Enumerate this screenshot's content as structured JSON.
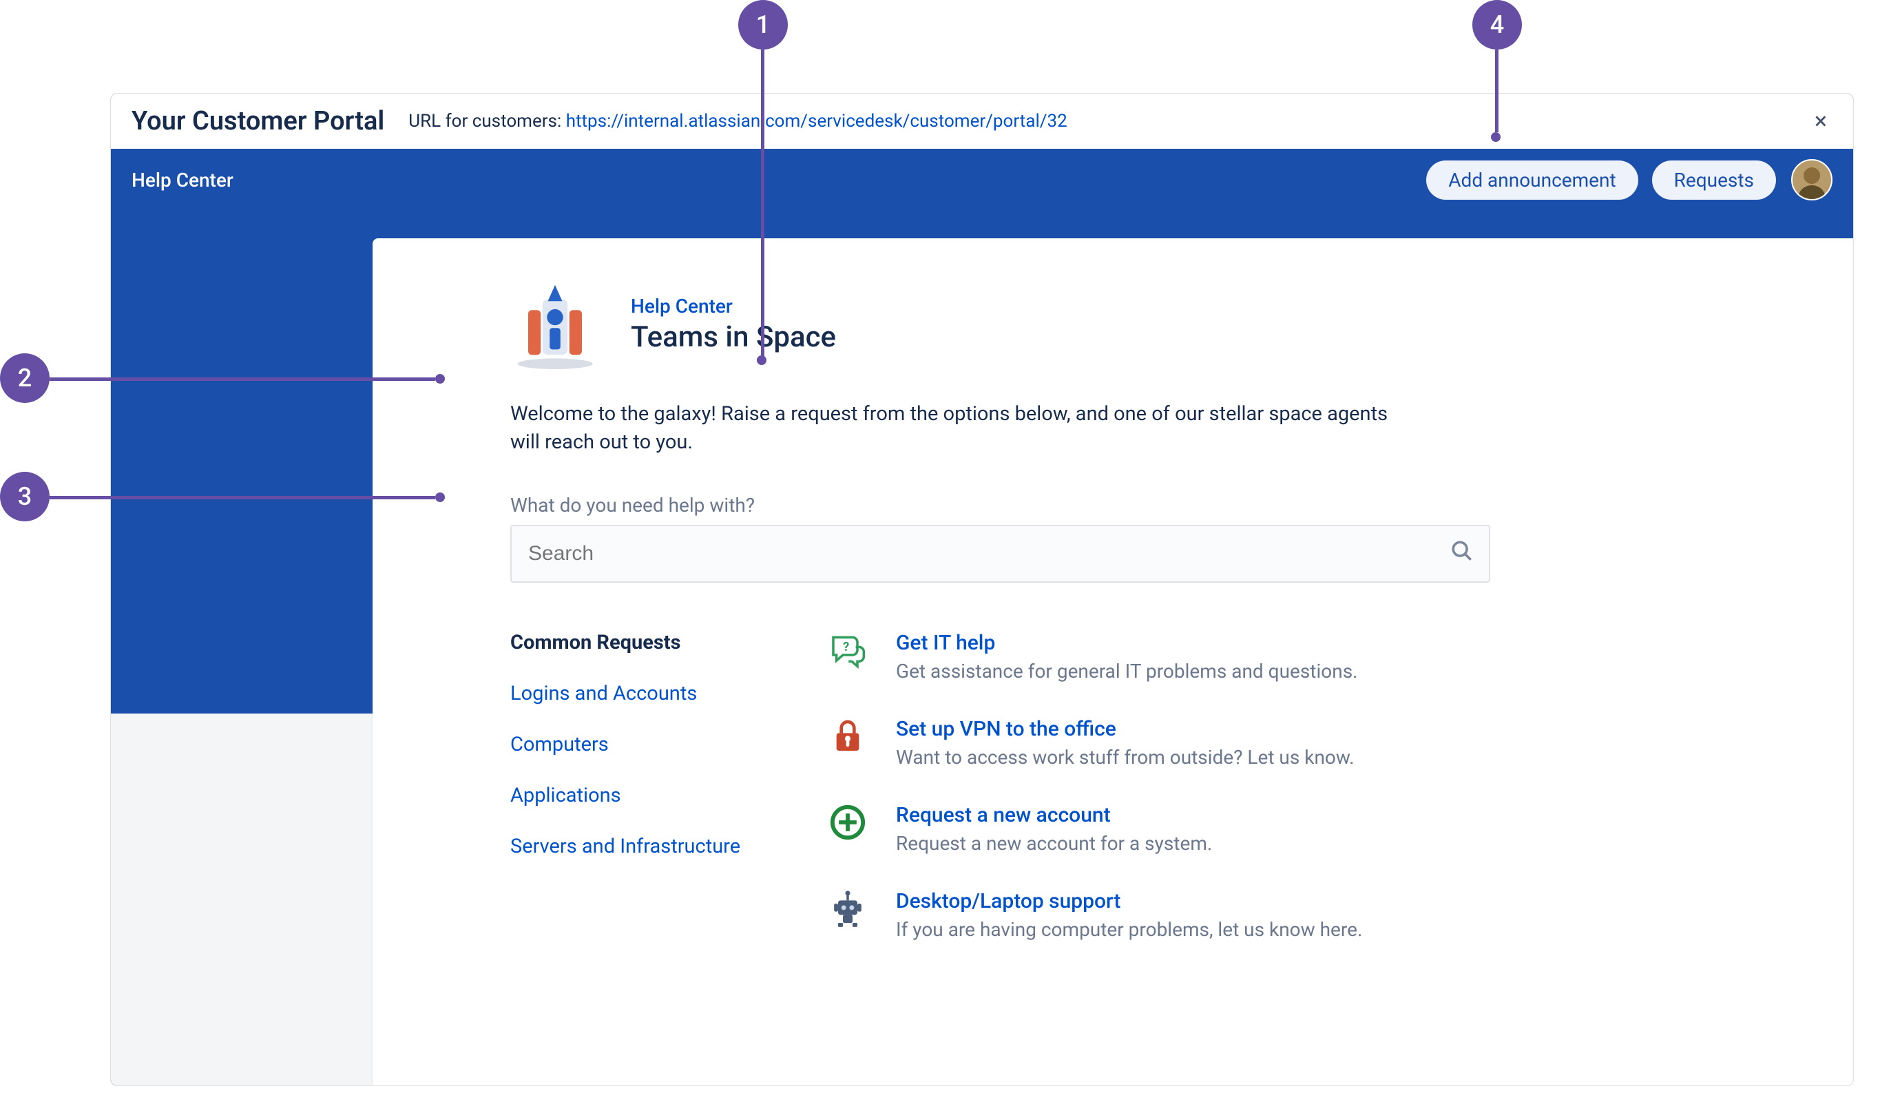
{
  "topbar": {
    "title": "Your Customer Portal",
    "url_label": "URL for customers: ",
    "url": "https://internal.atlassian.com/servicedesk/customer/portal/32",
    "close_glyph": "×"
  },
  "brandstrip": {
    "help_center_label": "Help Center",
    "add_announcement_label": "Add announcement",
    "requests_label": "Requests"
  },
  "header": {
    "breadcrumb": "Help Center",
    "project_title": "Teams in Space"
  },
  "welcome_text": "Welcome to the galaxy! Raise a request from the options below, and one of our stellar space agents will reach out to you.",
  "search": {
    "label": "What do you need help with?",
    "placeholder": "Search"
  },
  "categories": [
    {
      "label": "Common Requests",
      "active": true
    },
    {
      "label": "Logins and Accounts",
      "active": false
    },
    {
      "label": "Computers",
      "active": false
    },
    {
      "label": "Applications",
      "active": false
    },
    {
      "label": "Servers and Infrastructure",
      "active": false
    }
  ],
  "requests": [
    {
      "icon": "chat-question",
      "title": "Get IT help",
      "desc": "Get assistance for general IT problems and questions."
    },
    {
      "icon": "lock",
      "title": "Set up VPN to the office",
      "desc": "Want to access work stuff from outside? Let us know."
    },
    {
      "icon": "plus-circle",
      "title": "Request a new account",
      "desc": "Request a new account for a system."
    },
    {
      "icon": "robot",
      "title": "Desktop/Laptop support",
      "desc": "If you are having computer problems, let us know here."
    }
  ],
  "callouts": {
    "1": "1",
    "2": "2",
    "3": "3",
    "4": "4"
  }
}
